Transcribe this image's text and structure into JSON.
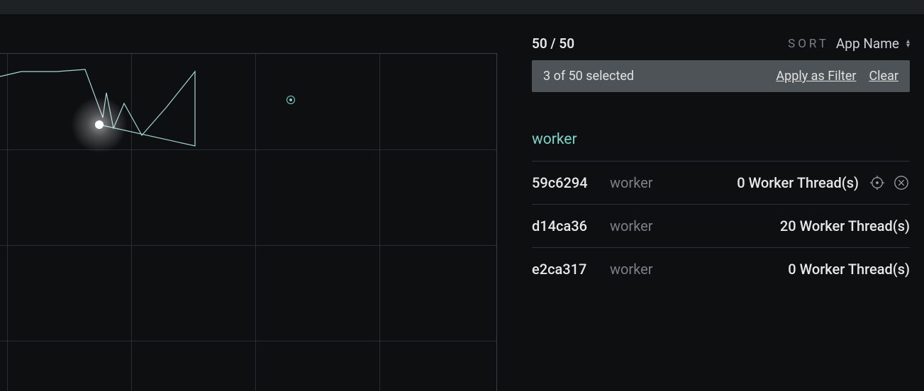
{
  "header": {
    "count_text": "50 / 50",
    "sort_label": "SORT",
    "sort_value": "App Name"
  },
  "selection_bar": {
    "text": "3 of 50 selected",
    "apply_label": "Apply as Filter",
    "clear_label": "Clear"
  },
  "group": {
    "label": "worker"
  },
  "rows": [
    {
      "id": "59c6294",
      "app": "worker",
      "threads": "0 Worker Thread(s)",
      "show_actions": true
    },
    {
      "id": "d14ca36",
      "app": "worker",
      "threads": "20 Worker Thread(s)",
      "show_actions": false
    },
    {
      "id": "e2ca317",
      "app": "worker",
      "threads": "0 Worker Thread(s)",
      "show_actions": false
    }
  ],
  "chart_data": {
    "type": "line",
    "title": "",
    "xlabel": "",
    "ylabel": "",
    "x": [
      0,
      30,
      80,
      120,
      145,
      150,
      160,
      175,
      200,
      235,
      275,
      275,
      140
    ],
    "y": [
      32,
      25,
      25,
      22,
      90,
      55,
      105,
      70,
      115,
      75,
      25,
      130,
      100
    ],
    "highlight_point": {
      "x": 140,
      "y": 100
    },
    "secondary_point": {
      "x": 410,
      "y": 65
    },
    "grid_x": [
      10,
      185,
      360,
      535
    ],
    "grid_y": [
      135,
      270,
      405
    ],
    "xlim": [
      0,
      700
    ],
    "ylim": [
      0,
      480
    ]
  }
}
